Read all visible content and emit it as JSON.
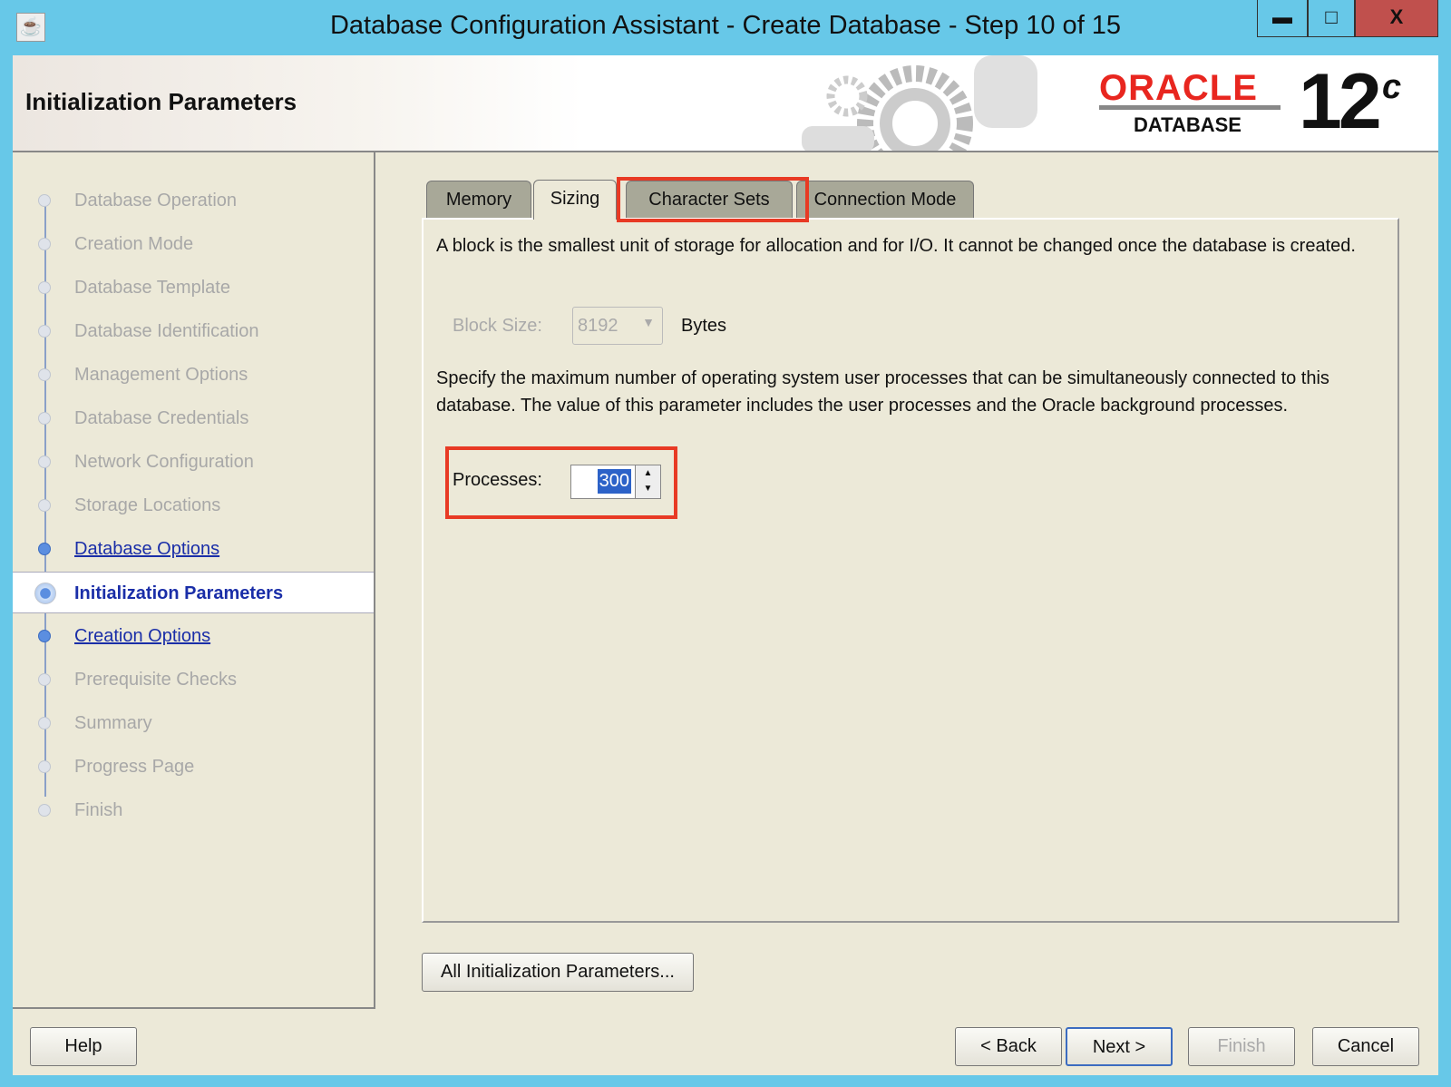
{
  "window": {
    "title": "Database Configuration Assistant - Create Database - Step 10 of 15",
    "minimize": "▬",
    "maximize": "□",
    "close": "X"
  },
  "header": {
    "title": "Initialization Parameters",
    "logo_brand": "ORACLE",
    "logo_product": "DATABASE",
    "logo_version": "12",
    "logo_suffix": "c"
  },
  "steps": [
    {
      "label": "Database Operation",
      "state": "disabled"
    },
    {
      "label": "Creation Mode",
      "state": "disabled"
    },
    {
      "label": "Database Template",
      "state": "disabled"
    },
    {
      "label": "Database Identification",
      "state": "disabled"
    },
    {
      "label": "Management Options",
      "state": "disabled"
    },
    {
      "label": "Database Credentials",
      "state": "disabled"
    },
    {
      "label": "Network Configuration",
      "state": "disabled"
    },
    {
      "label": "Storage Locations",
      "state": "disabled"
    },
    {
      "label": "Database Options",
      "state": "link"
    },
    {
      "label": "Initialization Parameters",
      "state": "current"
    },
    {
      "label": "Creation Options",
      "state": "link"
    },
    {
      "label": "Prerequisite Checks",
      "state": "disabled"
    },
    {
      "label": "Summary",
      "state": "disabled"
    },
    {
      "label": "Progress Page",
      "state": "disabled"
    },
    {
      "label": "Finish",
      "state": "disabled"
    }
  ],
  "tabs": [
    "Memory",
    "Sizing",
    "Character Sets",
    "Connection Mode"
  ],
  "active_tab": "Sizing",
  "sizing": {
    "block_desc": "A block is the smallest unit of storage for allocation and for I/O. It cannot be changed once the database is created.",
    "block_size_label": "Block Size:",
    "block_size_value": "8192",
    "block_size_unit": "Bytes",
    "processes_desc": "Specify the maximum number of operating system user processes that can be simultaneously connected to this database. The value of this parameter includes the user processes and the Oracle background processes.",
    "processes_label": "Processes:",
    "processes_value": "300"
  },
  "buttons": {
    "all_params": "All Initialization Parameters...",
    "help": "Help",
    "back": "< Back",
    "next": "Next >",
    "finish": "Finish",
    "cancel": "Cancel"
  },
  "colors": {
    "titlebar": "#67c8e8",
    "highlight": "#e83a24",
    "link": "#1a2ea8"
  }
}
